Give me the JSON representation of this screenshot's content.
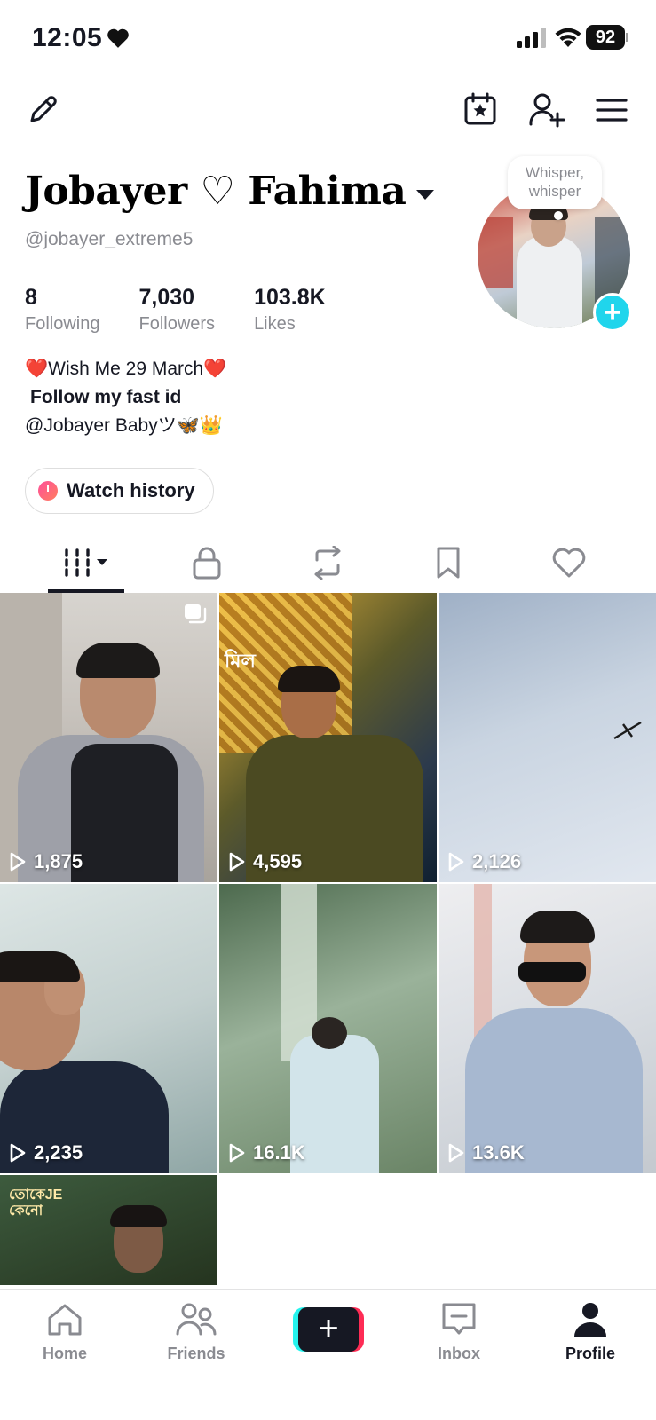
{
  "status_bar": {
    "time": "12:05",
    "battery": "92"
  },
  "profile": {
    "display_name": "Jobayer ♡ Fahima",
    "username": "@jobayer_extreme5",
    "stats": [
      {
        "value": "8",
        "label": "Following"
      },
      {
        "value": "7,030",
        "label": "Followers"
      },
      {
        "value": "103.8K",
        "label": "Likes"
      }
    ],
    "bio": [
      "❤️Wish Me 29 March❤️",
      "Follow my fast id",
      "@Jobayer Babyツ🦋👑"
    ],
    "watch_history_label": "Watch history",
    "whisper_line1": "Whisper,",
    "whisper_line2": "whisper"
  },
  "videos": [
    {
      "views": "1,875"
    },
    {
      "views": "4,595"
    },
    {
      "views": "2,126"
    },
    {
      "views": "2,235"
    },
    {
      "views": "16.1K"
    },
    {
      "views": "13.6K"
    },
    {
      "views": ""
    }
  ],
  "tile7_overlay_text": "তোকেJE কেনো",
  "tile2_overlay_text": "মিল",
  "nav": {
    "home": "Home",
    "friends": "Friends",
    "inbox": "Inbox",
    "profile": "Profile"
  },
  "colors": {
    "accent_cyan": "#20d5ec",
    "brand_pink": "#fe2c55",
    "brand_cyan": "#25f4ee",
    "text_primary": "#161823",
    "text_secondary": "#8a8b91"
  },
  "icons": {
    "edit": "pencil-icon",
    "calendar": "calendar-star-icon",
    "add_friend": "add-user-icon",
    "menu": "hamburger-menu-icon",
    "tab_videos": "grid-icon",
    "tab_private": "lock-icon",
    "tab_reposts": "repost-icon",
    "tab_saved": "bookmark-icon",
    "tab_liked": "heart-icon"
  }
}
